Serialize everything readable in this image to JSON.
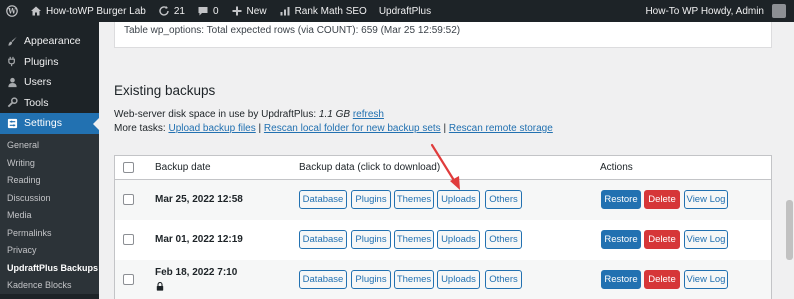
{
  "adminbar": {
    "site_name": "How-toWP Burger Lab",
    "updates_count": "21",
    "comments_count": "0",
    "new_label": "New",
    "rankmath_label": "Rank Math SEO",
    "updraft_label": "UpdraftPlus",
    "account_label": "How-To WP Howdy, Admin"
  },
  "sidebar": {
    "items": [
      {
        "label": "Appearance",
        "icon": "paintbrush-icon"
      },
      {
        "label": "Plugins",
        "icon": "plug-icon"
      },
      {
        "label": "Users",
        "icon": "user-icon"
      },
      {
        "label": "Tools",
        "icon": "wrench-icon"
      },
      {
        "label": "Settings",
        "icon": "settings-icon"
      }
    ],
    "submenu": [
      "General",
      "Writing",
      "Reading",
      "Discussion",
      "Media",
      "Permalinks",
      "Privacy",
      "UpdraftPlus Backups",
      "Kadence Blocks"
    ]
  },
  "main": {
    "top_panel_text": "Table wp_options: Total expected rows (via COUNT): 659 (Mar 25 12:59:52)",
    "heading": "Existing backups",
    "disk_prefix": "Web-server disk space in use by UpdraftPlus:",
    "disk_value": "1.1 GB",
    "disk_refresh": "refresh",
    "tasks_prefix": "More tasks:",
    "task_upload": "Upload backup files",
    "task_sep1": "|",
    "task_rescan_local": "Rescan local folder for new backup sets",
    "task_sep2": "|",
    "task_rescan_remote": "Rescan remote storage"
  },
  "table": {
    "headers": {
      "date": "Backup date",
      "data": "Backup data (click to download)",
      "actions": "Actions"
    },
    "data_buttons": [
      "Database",
      "Plugins",
      "Themes",
      "Uploads",
      "Others"
    ],
    "action_buttons": {
      "restore": "Restore",
      "delete": "Delete",
      "view_log": "View Log"
    },
    "rows": [
      {
        "date": "Mar 25, 2022 12:58",
        "locked": false
      },
      {
        "date": "Mar 01, 2022 12:19",
        "locked": false
      },
      {
        "date": "Feb 18, 2022 7:10",
        "locked": true
      }
    ]
  },
  "colors": {
    "admin_dark": "#1d2327",
    "primary": "#2271b1",
    "danger": "#d63638",
    "annotation_arrow": "#e03c3c"
  }
}
